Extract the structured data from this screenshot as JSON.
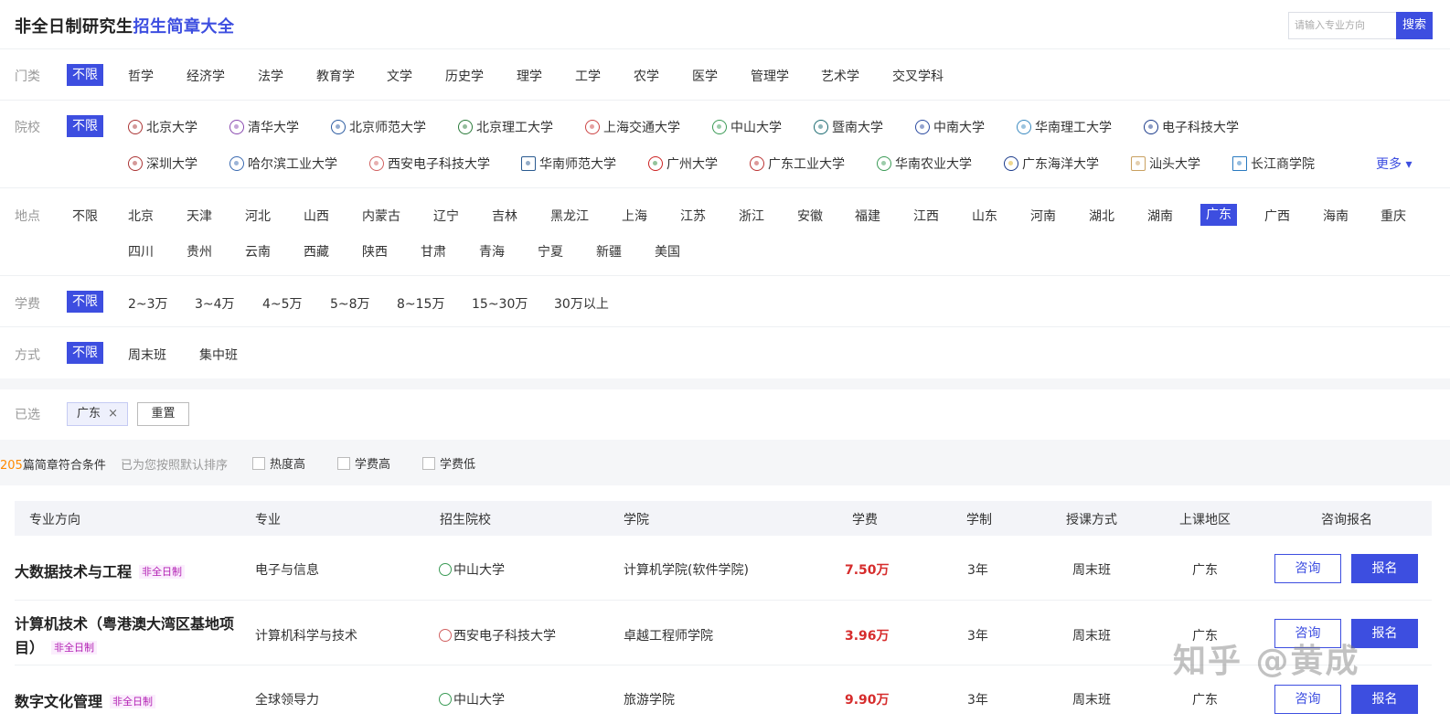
{
  "header": {
    "title_a": "非全日制研究生",
    "title_b": "招生简章大全",
    "search_placeholder": "请输入专业方向",
    "search_button": "搜索"
  },
  "filters": {
    "category": {
      "label": "门类",
      "options": [
        "不限",
        "哲学",
        "经济学",
        "法学",
        "教育学",
        "文学",
        "历史学",
        "理学",
        "工学",
        "农学",
        "医学",
        "管理学",
        "艺术学",
        "交叉学科"
      ],
      "selected": "不限"
    },
    "school": {
      "label": "院校",
      "selected_label": "不限",
      "row1": [
        "北京大学",
        "清华大学",
        "北京师范大学",
        "北京理工大学",
        "上海交通大学",
        "中山大学",
        "暨南大学",
        "中南大学",
        "华南理工大学",
        "电子科技大学"
      ],
      "row2": [
        "深圳大学",
        "哈尔滨工业大学",
        "西安电子科技大学",
        "华南师范大学",
        "广州大学",
        "广东工业大学",
        "华南农业大学",
        "广东海洋大学",
        "汕头大学",
        "长江商学院"
      ],
      "more": "更多 ▾"
    },
    "location": {
      "label": "地点",
      "row1": [
        "不限",
        "北京",
        "天津",
        "河北",
        "山西",
        "内蒙古",
        "辽宁",
        "吉林",
        "黑龙江",
        "上海",
        "江苏",
        "浙江",
        "安徽",
        "福建",
        "江西",
        "山东",
        "河南",
        "湖北",
        "湖南",
        "广东",
        "广西",
        "海南",
        "重庆"
      ],
      "row2": [
        "四川",
        "贵州",
        "云南",
        "西藏",
        "陕西",
        "甘肃",
        "青海",
        "宁夏",
        "新疆",
        "美国"
      ],
      "selected": "广东"
    },
    "tuition": {
      "label": "学费",
      "options": [
        "不限",
        "2~3万",
        "3~4万",
        "4~5万",
        "5~8万",
        "8~15万",
        "15~30万",
        "30万以上"
      ],
      "selected": "不限"
    },
    "mode": {
      "label": "方式",
      "options": [
        "不限",
        "周末班",
        "集中班"
      ],
      "selected": "不限"
    }
  },
  "selected_bar": {
    "label": "已选",
    "chip": "广东",
    "chip_close": "×",
    "reset": "重置"
  },
  "results": {
    "count": "205",
    "count_suffix": "篇简章符合条件",
    "sort_hint": "已为您按照默认排序",
    "sort_options": [
      "热度高",
      "学费高",
      "学费低"
    ]
  },
  "table": {
    "headers": [
      "专业方向",
      "专业",
      "招生院校",
      "学院",
      "学费",
      "学制",
      "授课方式",
      "上课地区",
      "咨询报名"
    ],
    "rows": [
      {
        "direction_a": "大数据技术与工程",
        "direction_b": "",
        "tag": "非全日制",
        "major": "电子与信息",
        "school": "中山大学",
        "college": "计算机学院(软件学院)",
        "fee": "7.50万",
        "years": "3年",
        "mode": "周末班",
        "area": "广东",
        "consult": "咨询",
        "apply": "报名"
      },
      {
        "direction_a": "计算机技术（粤港澳大湾区基地项",
        "direction_b": "目）",
        "tag": "非全日制",
        "major": "计算机科学与技术",
        "school": "西安电子科技大学",
        "college": "卓越工程师学院",
        "fee": "3.96万",
        "years": "3年",
        "mode": "周末班",
        "area": "广东",
        "consult": "咨询",
        "apply": "报名"
      },
      {
        "direction_a": "数字文化管理",
        "direction_b": "",
        "tag": "非全日制",
        "major": "全球领导力",
        "school": "中山大学",
        "college": "旅游学院",
        "fee": "9.90万",
        "years": "3年",
        "mode": "周末班",
        "area": "广东",
        "consult": "咨询",
        "apply": "报名"
      }
    ]
  },
  "watermark": "知乎 @黄成",
  "colors": {
    "accent": "#3d4ee0",
    "fee": "#d62c2c",
    "count": "#ff8a00",
    "tag": "#b21fb3"
  }
}
